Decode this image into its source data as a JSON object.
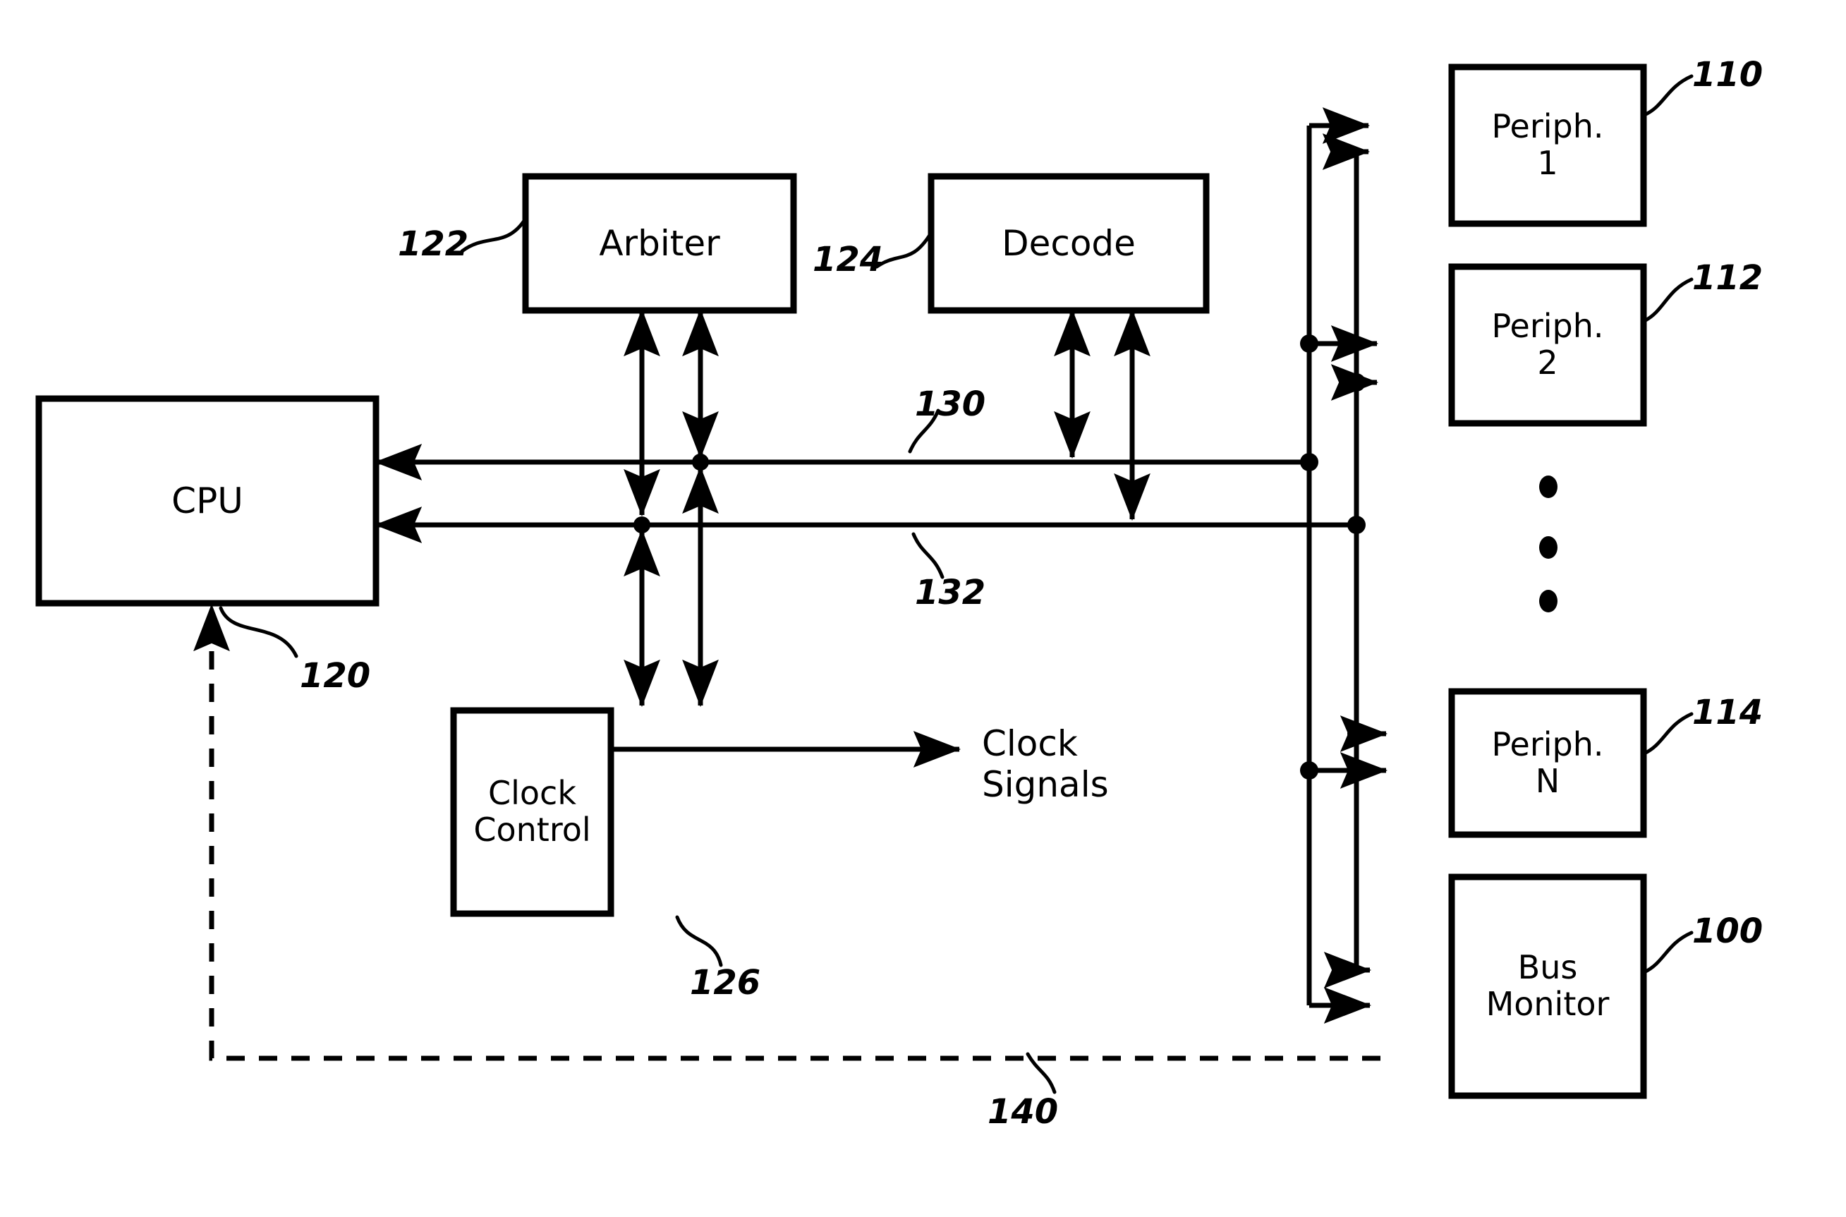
{
  "figure": {
    "type": "patent-block-diagram",
    "background": "#ffffff",
    "line_color": "#000000"
  },
  "blocks": {
    "cpu": {
      "label": "CPU",
      "ref": "120"
    },
    "arbiter": {
      "label": "Arbiter",
      "ref": "122"
    },
    "decode": {
      "label": "Decode",
      "ref": "124"
    },
    "clock_control": {
      "label": "Clock\nControl",
      "ref": "126"
    },
    "periph1": {
      "label": "Periph.\n1",
      "ref": "110"
    },
    "periph2": {
      "label": "Periph.\n2",
      "ref": "112"
    },
    "periphn": {
      "label": "Periph.\nN",
      "ref": "114"
    },
    "bus_monitor": {
      "label": "Bus\nMonitor",
      "ref": "100"
    }
  },
  "signals": {
    "clock_signals": {
      "label": "Clock\nSignals"
    }
  },
  "buses": {
    "upper": {
      "ref": "130"
    },
    "lower": {
      "ref": "132"
    },
    "feedback": {
      "ref": "140",
      "style": "dashed"
    }
  },
  "ellipsis": {
    "name": "vertical-ellipsis",
    "dots": 3
  }
}
